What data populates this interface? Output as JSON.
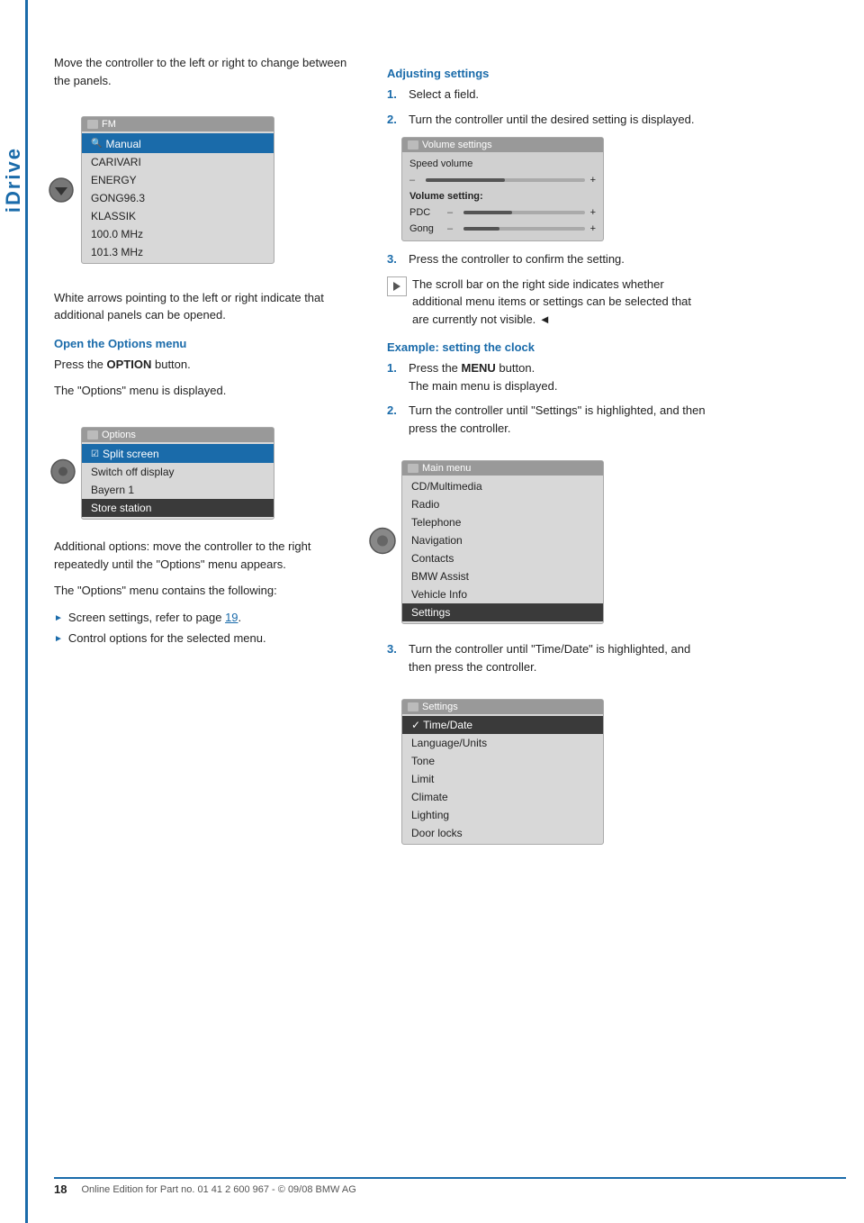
{
  "page": {
    "title": "iDrive",
    "page_number": "18",
    "footer_text": "Online Edition for Part no. 01 41 2 600 967  - © 09/08 BMW AG"
  },
  "left_col": {
    "intro_text": "Move the controller to the left or right to change between the panels.",
    "fm_screen": {
      "title": "FM",
      "items": [
        {
          "label": "Manual",
          "state": "highlighted"
        },
        {
          "label": "CARIVARI",
          "state": "normal"
        },
        {
          "label": "ENERGY",
          "state": "normal"
        },
        {
          "label": "GONG96.3",
          "state": "normal"
        },
        {
          "label": "KLASSIK",
          "state": "normal"
        },
        {
          "label": "100.0 MHz",
          "state": "normal"
        },
        {
          "label": "101.3 MHz",
          "state": "normal"
        }
      ]
    },
    "white_arrows_text": "White arrows pointing to the left or right indicate that additional panels can be opened.",
    "open_options_heading": "Open the Options menu",
    "open_options_para1": "Press the OPTION button.",
    "open_options_para1_bold": "OPTION",
    "open_options_para2": "The \"Options\" menu is displayed.",
    "options_screen": {
      "title": "Options",
      "items": [
        {
          "label": "Split screen",
          "state": "normal",
          "has_checkbox": true
        },
        {
          "label": "Switch off display",
          "state": "normal"
        },
        {
          "label": "Bayern 1",
          "state": "normal"
        },
        {
          "label": "Store station",
          "state": "selected"
        }
      ]
    },
    "additional_text": "Additional options: move the controller to the right repeatedly until the \"Options\" menu appears.",
    "contains_text": "The \"Options\" menu contains the following:",
    "bullet1": "Screen settings, refer to page 19.",
    "bullet1_link": "19",
    "bullet2": "Control options for the selected menu."
  },
  "right_col": {
    "adjusting_heading": "Adjusting settings",
    "step1": "Select a field.",
    "step2": "Turn the controller until the desired setting is displayed.",
    "volume_screen": {
      "title": "Volume settings",
      "speed_volume_label": "Speed volume",
      "volume_setting_label": "Volume setting:",
      "rows": [
        {
          "label": "PDC",
          "fill_pct": 40
        },
        {
          "label": "Gong",
          "fill_pct": 30
        }
      ]
    },
    "step3": "Press the controller to confirm the setting.",
    "scroll_note": "The scroll bar on the right side indicates whether additional menu items or settings can be selected that are currently not visible.",
    "end_marker": "◄",
    "example_heading": "Example: setting the clock",
    "ex_step1": "Press the MENU button.",
    "ex_step1_bold": "MENU",
    "ex_step1_sub": "The main menu is displayed.",
    "ex_step2": "Turn the controller until \"Settings\" is highlighted, and then press the controller.",
    "main_menu_screen": {
      "title": "Main menu",
      "items": [
        {
          "label": "CD/Multimedia",
          "state": "normal"
        },
        {
          "label": "Radio",
          "state": "normal"
        },
        {
          "label": "Telephone",
          "state": "normal"
        },
        {
          "label": "Navigation",
          "state": "normal"
        },
        {
          "label": "Contacts",
          "state": "normal"
        },
        {
          "label": "BMW Assist",
          "state": "normal"
        },
        {
          "label": "Vehicle Info",
          "state": "normal"
        },
        {
          "label": "Settings",
          "state": "selected"
        }
      ]
    },
    "ex_step3": "Turn the controller until \"Time/Date\" is highlighted, and then press the controller.",
    "settings_screen": {
      "title": "Settings",
      "items": [
        {
          "label": "Time/Date",
          "state": "selected",
          "has_check": true
        },
        {
          "label": "Language/Units",
          "state": "normal"
        },
        {
          "label": "Tone",
          "state": "normal"
        },
        {
          "label": "Limit",
          "state": "normal"
        },
        {
          "label": "Climate",
          "state": "normal"
        },
        {
          "label": "Lighting",
          "state": "normal"
        },
        {
          "label": "Door locks",
          "state": "normal"
        }
      ]
    }
  }
}
